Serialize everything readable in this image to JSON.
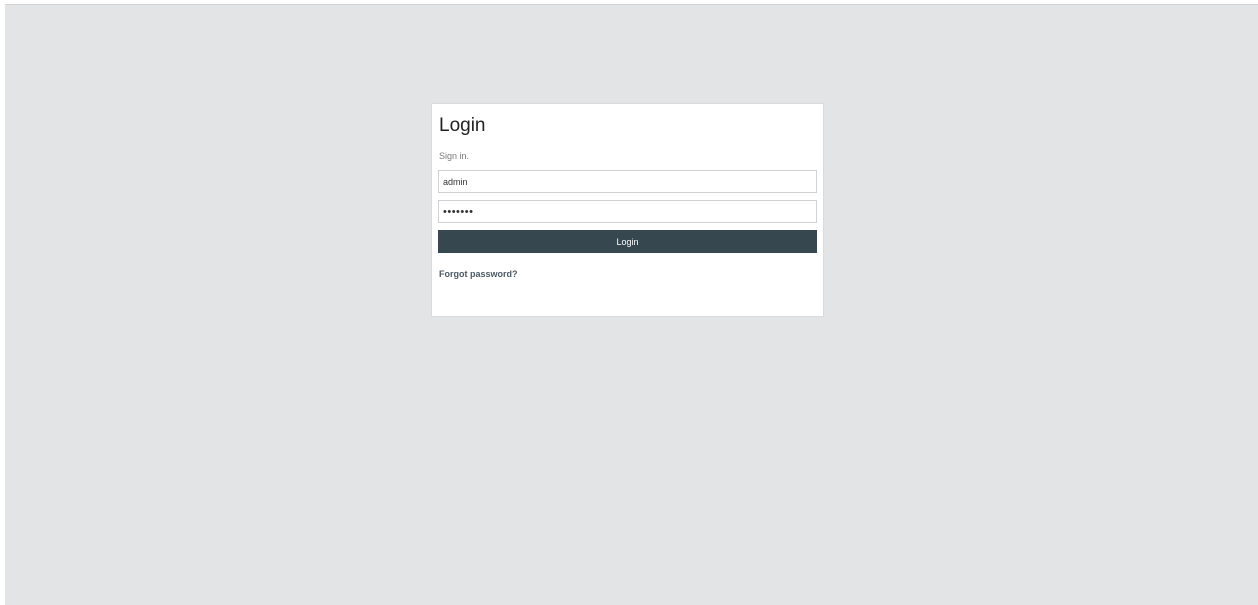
{
  "login": {
    "title": "Login",
    "subtitle": "Sign in.",
    "username_value": "admin",
    "password_value": "1234567",
    "button_label": "Login",
    "forgot_link": "Forgot password?"
  },
  "colors": {
    "page_background": "#e3e4e6",
    "card_background": "#ffffff",
    "button_background": "#37474f",
    "link_color": "#4a5964"
  }
}
